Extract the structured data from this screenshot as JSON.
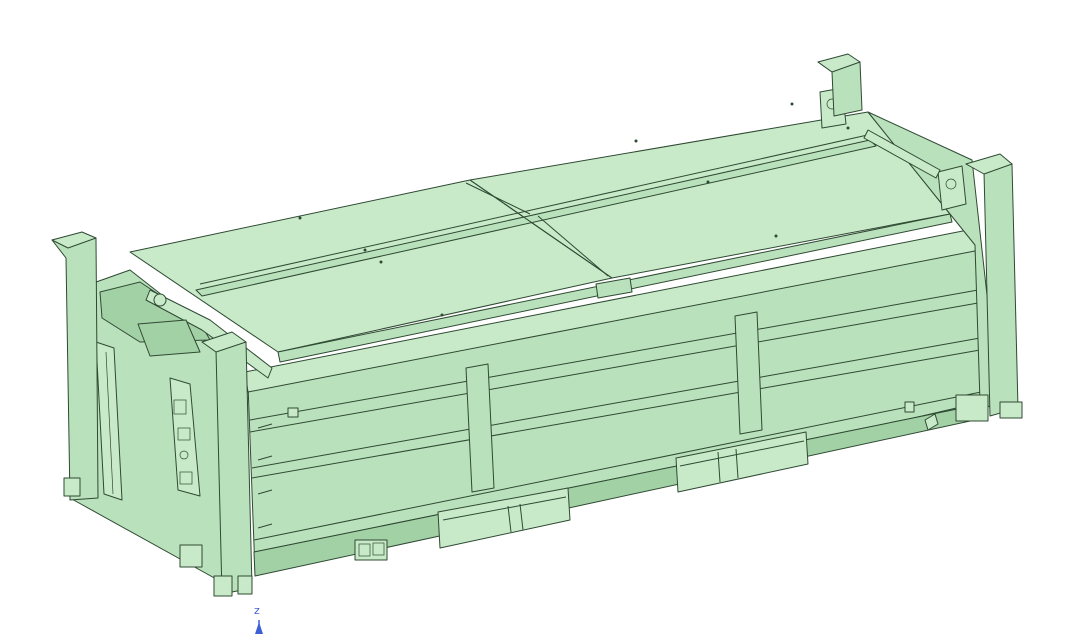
{
  "viewport": {
    "background": "#ffffff",
    "model_fill": "#b4deb6",
    "model_fill_light": "#c5e8c6",
    "model_fill_shadow": "#9bcc9f",
    "edge_color": "#2f4a33"
  },
  "axis_triad": {
    "label": "z",
    "color": "#3d5fd6"
  }
}
